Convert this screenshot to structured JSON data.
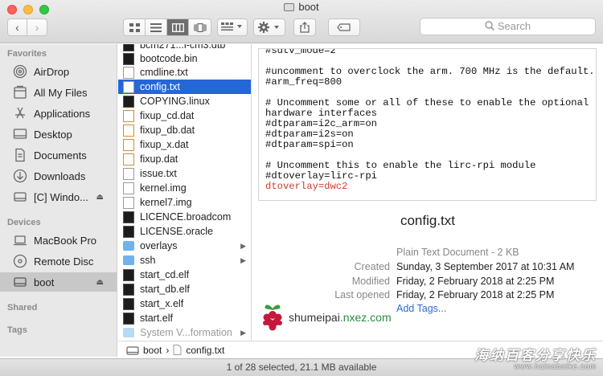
{
  "window": {
    "title": "boot"
  },
  "toolbar": {
    "back_label": "‹",
    "forward_label": "›",
    "search_placeholder": "Search"
  },
  "sidebar": {
    "favorites_header": "Favorites",
    "devices_header": "Devices",
    "shared_header": "Shared",
    "tags_header": "Tags",
    "favorites": [
      {
        "label": "AirDrop",
        "icon": "airdrop-icon"
      },
      {
        "label": "All My Files",
        "icon": "all-files-icon"
      },
      {
        "label": "Applications",
        "icon": "applications-icon"
      },
      {
        "label": "Desktop",
        "icon": "desktop-icon"
      },
      {
        "label": "Documents",
        "icon": "documents-icon"
      },
      {
        "label": "Downloads",
        "icon": "downloads-icon"
      },
      {
        "label": "[C] Windo...",
        "icon": "drive-icon"
      }
    ],
    "devices": [
      {
        "label": "MacBook Pro",
        "icon": "laptop-icon"
      },
      {
        "label": "Remote Disc",
        "icon": "disc-icon"
      },
      {
        "label": "boot",
        "icon": "drive-icon"
      }
    ]
  },
  "files": [
    {
      "name": "bcm271...i-cm3.dtb",
      "type": "term"
    },
    {
      "name": "bootcode.bin",
      "type": "term"
    },
    {
      "name": "cmdline.txt",
      "type": "doc"
    },
    {
      "name": "config.txt",
      "type": "doc",
      "selected": true
    },
    {
      "name": "COPYING.linux",
      "type": "term"
    },
    {
      "name": "fixup_cd.dat",
      "type": "dat"
    },
    {
      "name": "fixup_db.dat",
      "type": "dat"
    },
    {
      "name": "fixup_x.dat",
      "type": "dat"
    },
    {
      "name": "fixup.dat",
      "type": "dat"
    },
    {
      "name": "issue.txt",
      "type": "doc"
    },
    {
      "name": "kernel.img",
      "type": "doc"
    },
    {
      "name": "kernel7.img",
      "type": "doc"
    },
    {
      "name": "LICENCE.broadcom",
      "type": "term"
    },
    {
      "name": "LICENSE.oracle",
      "type": "term"
    },
    {
      "name": "overlays",
      "type": "folder"
    },
    {
      "name": "ssh",
      "type": "folder"
    },
    {
      "name": "start_cd.elf",
      "type": "term"
    },
    {
      "name": "start_db.elf",
      "type": "term"
    },
    {
      "name": "start_x.elf",
      "type": "term"
    },
    {
      "name": "start.elf",
      "type": "term"
    },
    {
      "name": "System V...formation",
      "type": "folder",
      "dim": true
    }
  ],
  "preview": {
    "code_lines": [
      "#sdtv_mode=2",
      "",
      "#uncomment to overclock the arm. 700 MHz is the default.",
      "#arm_freq=800",
      "",
      "# Uncomment some or all of these to enable the optional",
      "hardware interfaces",
      "#dtparam=i2c_arm=on",
      "#dtparam=i2s=on",
      "#dtparam=spi=on",
      "",
      "# Uncomment this to enable the lirc-rpi module",
      "#dtoverlay=lirc-rpi",
      "dtoverlay=dwc2"
    ],
    "highlighted_line": "dtoverlay=dwc2",
    "file_name": "config.txt",
    "kind": "Plain Text Document - 2 KB",
    "created_label": "Created",
    "created": "Sunday, 3 September 2017 at 10:31 AM",
    "modified_label": "Modified",
    "modified": "Friday, 2 February 2018 at 2:25 PM",
    "last_opened_label": "Last opened",
    "last_opened": "Friday, 2 February 2018 at 2:25 PM",
    "add_tags": "Add Tags..."
  },
  "logo": {
    "brand": "shumeipai",
    "domain": ".nxez.com"
  },
  "pathbar": {
    "root": "boot",
    "separator": "›",
    "file": "config.txt"
  },
  "status": "1 of 28 selected, 21.1 MB available",
  "watermark": {
    "line1": "海纳百客分享快乐",
    "line2": "www.hainabaike.com"
  },
  "colors": {
    "selection": "#2567d7",
    "sidebar_bg": "#e8e8e8",
    "highlight_code": "#d23b2c",
    "link": "#2a6ad6"
  }
}
